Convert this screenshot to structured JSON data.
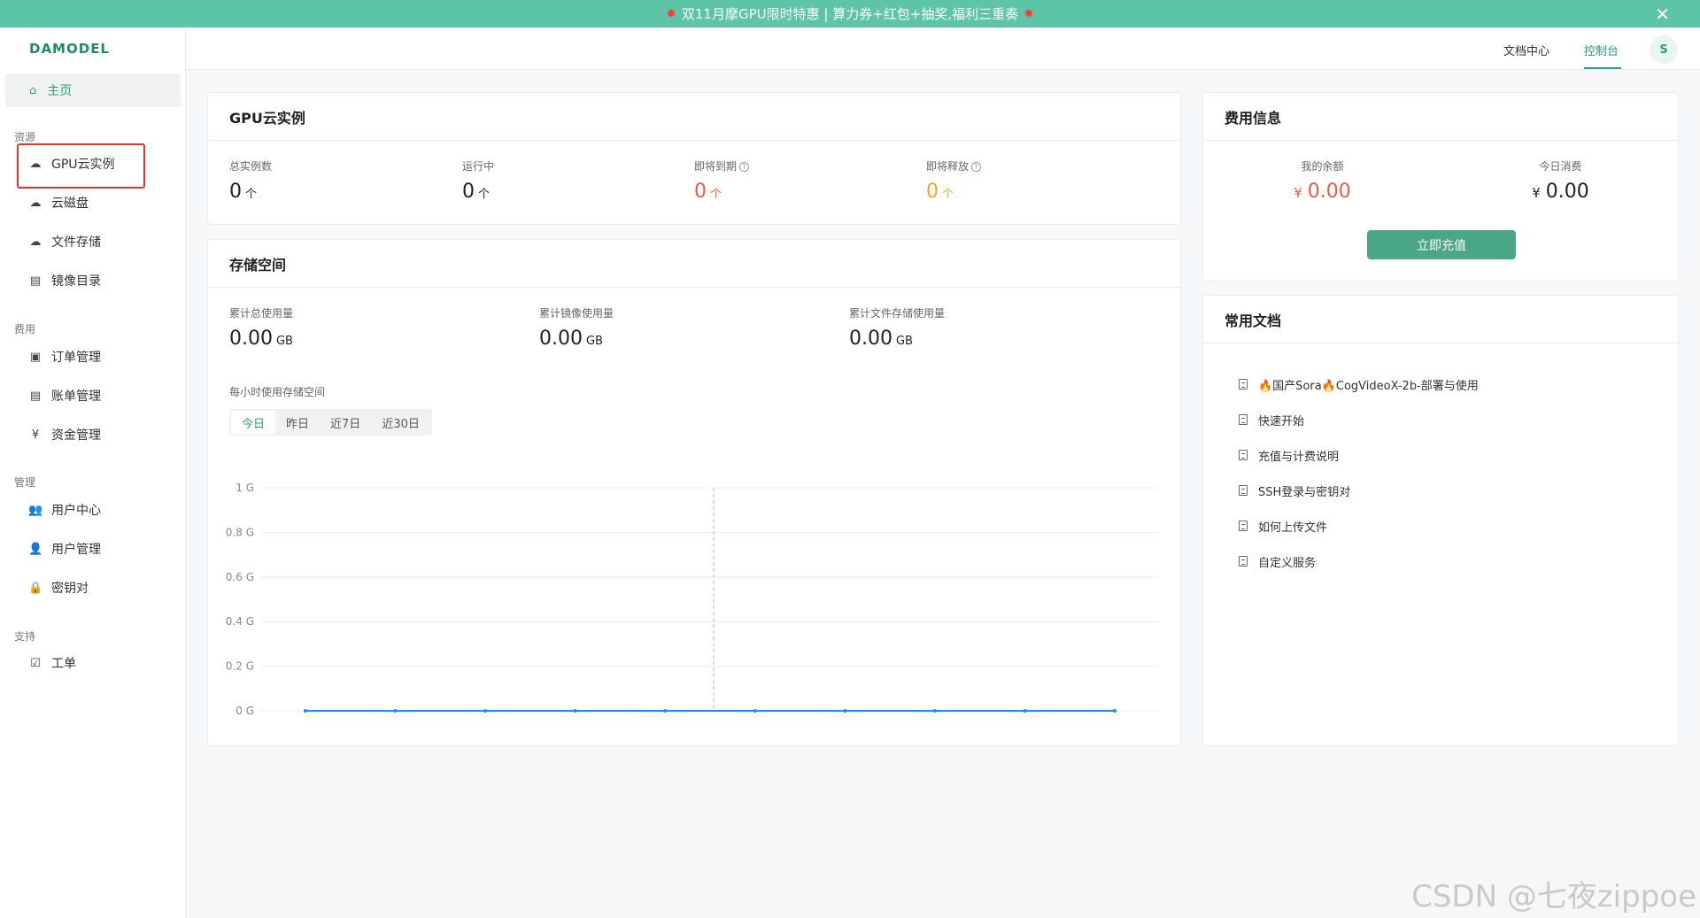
{
  "banner": {
    "text": "双11月摩GPU限时特惠 | 算力券+红包+抽奖,福利三重奏",
    "burst_glyph": "✸",
    "close_glyph": "✕"
  },
  "sidebar": {
    "logo": "DAMODEL",
    "home": "主页",
    "sections": {
      "resources": "资源",
      "billing": "费用",
      "management": "管理",
      "support": "支持"
    },
    "items": {
      "gpu": "GPU云实例",
      "disk": "云磁盘",
      "file": "文件存储",
      "image": "镜像目录",
      "orders": "订单管理",
      "bills": "账单管理",
      "funds": "资金管理",
      "user_center": "用户中心",
      "user_mgmt": "用户管理",
      "keypair": "密钥对",
      "ticket": "工单"
    },
    "icons": {
      "home": "⌂",
      "gpu": "☁",
      "disk": "☁",
      "file": "☁",
      "image": "▤",
      "orders": "▣",
      "bills": "▤",
      "funds": "¥",
      "user_center": "👥",
      "user_mgmt": "👤",
      "keypair": "🔒",
      "ticket": "☑"
    }
  },
  "topbar": {
    "docs": "文档中心",
    "console": "控制台",
    "avatar": "S"
  },
  "gpu_card": {
    "title": "GPU云实例",
    "stats": [
      {
        "label": "总实例数",
        "value": "0",
        "unit": "个"
      },
      {
        "label": "运行中",
        "value": "0",
        "unit": "个"
      },
      {
        "label": "即将到期",
        "value": "0",
        "unit": "个"
      },
      {
        "label": "即将释放",
        "value": "0",
        "unit": "个"
      }
    ],
    "help_glyph": "?",
    "colors": {
      "normal": "#222222",
      "expiring": "#f05a4a",
      "releasing": "#f5a623"
    }
  },
  "storage_card": {
    "title": "存储空间",
    "stats": [
      {
        "label": "累计总使用量",
        "value": "0.00",
        "unit": "GB"
      },
      {
        "label": "累计镜像使用量",
        "value": "0.00",
        "unit": "GB"
      },
      {
        "label": "累计文件存储使用量",
        "value": "0.00",
        "unit": "GB"
      }
    ],
    "hourly_label": "每小时使用存储空间",
    "tabs": [
      "今日",
      "昨日",
      "近7日",
      "近30日"
    ],
    "active_tab": "今日"
  },
  "chart_data": {
    "type": "line",
    "title": "",
    "xlabel": "",
    "ylabel": "",
    "y_ticks": [
      "1 G",
      "0.8 G",
      "0.6 G",
      "0.4 G",
      "0.2 G",
      "0 G"
    ],
    "ylim": [
      0,
      1
    ],
    "series": [
      {
        "values": [
          0,
          0,
          0,
          0,
          0,
          0,
          0,
          0,
          0,
          0
        ]
      }
    ],
    "line_color": "#1890ff",
    "grid": true
  },
  "fee_card": {
    "title": "费用信息",
    "balance_label": "我的余额",
    "balance_currency": "¥",
    "balance_value": "0.00",
    "today_label": "今日消费",
    "today_currency": "¥",
    "today_value": "0.00",
    "recharge_button": "立即充值",
    "balance_color": "#f05a4a"
  },
  "docs_card": {
    "title": "常用文档",
    "items": [
      "🔥国产Sora🔥CogVideoX-2b-部署与使用",
      "快速开始",
      "充值与计费说明",
      "SSH登录与密钥对",
      "如何上传文件",
      "自定义服务"
    ]
  },
  "watermark": "CSDN @七夜zippoe"
}
